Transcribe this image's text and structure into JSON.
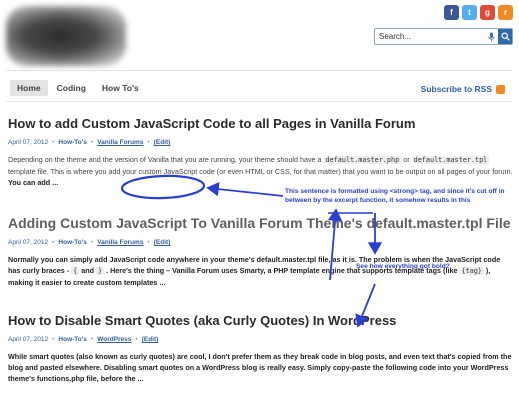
{
  "search": {
    "placeholder": "Search..."
  },
  "nav": {
    "tabs": [
      {
        "label": "Home"
      },
      {
        "label": "Coding"
      },
      {
        "label": "How To's"
      }
    ]
  },
  "rss": {
    "label": "Subscribe to RSS"
  },
  "posts": [
    {
      "title": "How to add Custom JavaScript Code to all Pages in Vanilla Forum",
      "date": "April 07, 2012",
      "category": "How-To's",
      "tag": "Vanilla Forums",
      "edit": "(Edit)",
      "excerpt": {
        "a": "Depending on the theme and the version of Vanilla that you are running, your theme should have a",
        "code1": "default.master.php",
        "b": "or",
        "code2": "default.master.tpl",
        "c": "template file. This is where you add your custom JavaScript code (or even HTML or CSS, for that matter) that you want to be output on all pages of your forum.",
        "bold": "You can add ..."
      }
    },
    {
      "title": "Adding Custom JavaScript To Vanilla Forum Theme's default.master.tpl File",
      "date": "April 07, 2012",
      "category": "How-To's",
      "tag": "Vanilla Forums",
      "edit": "(Edit)",
      "excerpt": {
        "a": "Normally you can simply add JavaScript code anywhere in your theme's default.master.tpl file, as it is. The problem is when the JavaScript code has curly braces -",
        "code1": "{",
        "b": "and",
        "code2": "}",
        "c": ". Here's the thing – Vanilla Forum uses Smarty, a PHP template engine that supports template tags (like",
        "code3": "{tag}",
        "d": "), making it easier to create custom templates ..."
      }
    },
    {
      "title": "How to Disable Smart Quotes (aka Curly Quotes) In WordPress",
      "date": "April 07, 2012",
      "category": "How-To's",
      "tag": "WordPress",
      "edit": "(Edit)",
      "excerpt": "While smart quotes (also known as curly quotes) are cool, I don't prefer them as they break code in blog posts, and even text that's copied from the blog and pasted elsewhere. Disabling smart quotes on a WordPress blog is really easy. Simply copy-paste the following code into your WordPress theme's functions.php file, before the ..."
    }
  ],
  "annotations": {
    "note1": "This sentence is formatted using <strong> tag, and since it's cut off in between by the excerpt function, it somehow results in this",
    "note2": "See how everything got bold?"
  },
  "colors": {
    "accent": "#2f5f9e",
    "annotation": "#2b3fd0",
    "rss": "#f08a24"
  },
  "icons": [
    "social-icon",
    "social-icon",
    "social-icon",
    "social-icon",
    "mic-icon",
    "search-icon",
    "rss-icon"
  ]
}
